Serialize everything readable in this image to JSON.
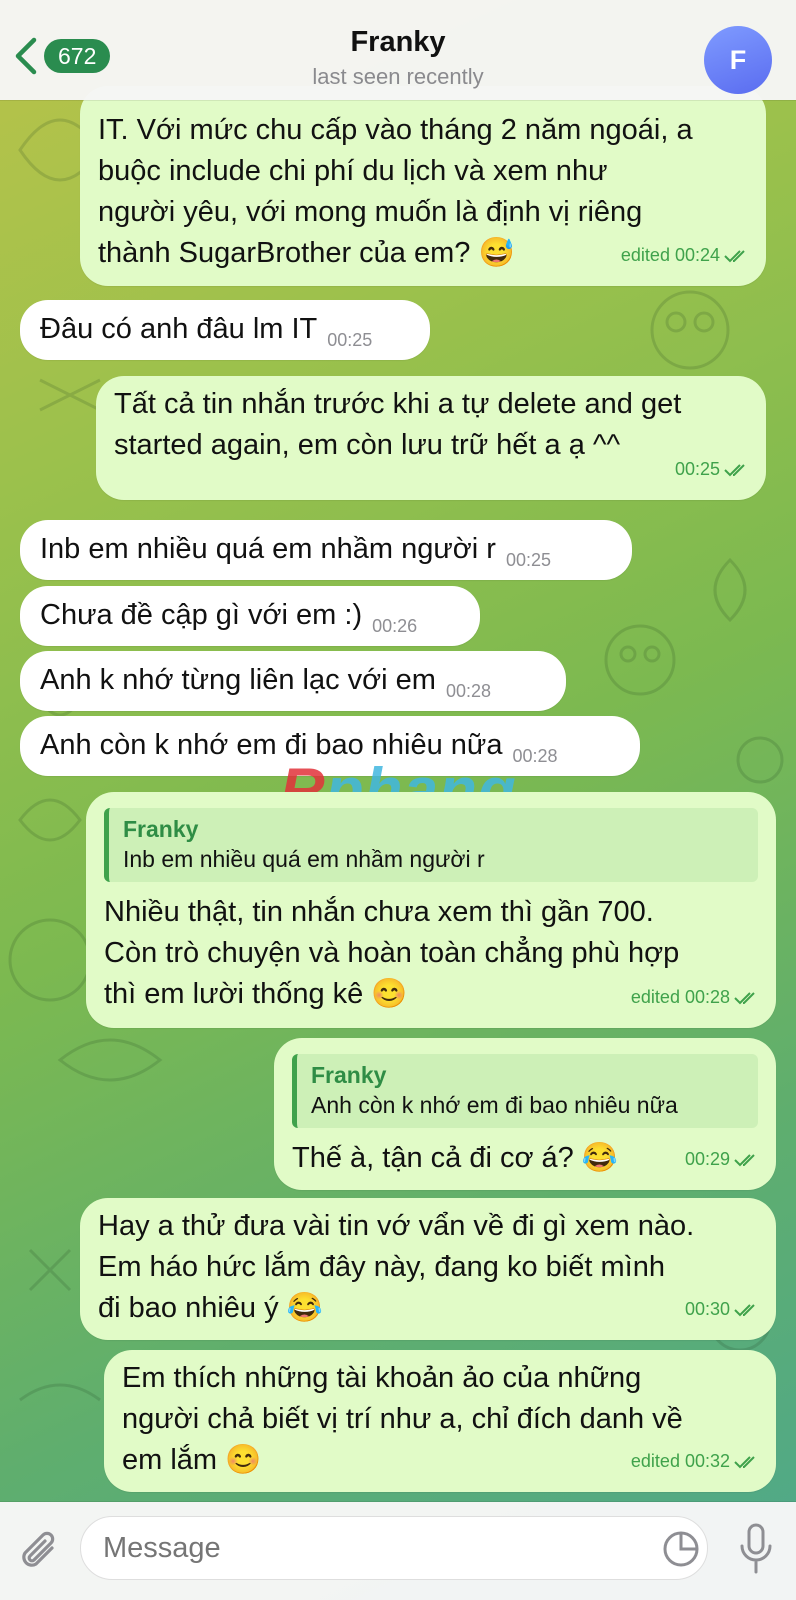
{
  "header": {
    "back_count": "672",
    "title": "Franky",
    "status": "last seen recently",
    "avatar_letter": "F"
  },
  "messages": [
    {
      "dir": "out",
      "text": "IT. Với mức chu cấp vào tháng 2 năm ngoái, a\nbuộc include chi phí du lịch và xem như\nngười yêu, với mong muốn là định vị riêng\nthành SugarBrother của em? 😅",
      "time": "edited 00:24"
    },
    {
      "dir": "in",
      "text": "Đâu có anh đâu lm IT",
      "time": "00:25"
    },
    {
      "dir": "out",
      "text": "Tất cả tin nhắn trước khi a tự delete and get\nstarted again, em còn lưu trữ hết a ạ ^^",
      "time": "00:25"
    },
    {
      "dir": "in",
      "text": "Inb em nhiều quá em nhầm người r",
      "time": "00:25"
    },
    {
      "dir": "in",
      "text": "Chưa đề cập gì với em :)",
      "time": "00:26"
    },
    {
      "dir": "in",
      "text": "Anh k nhớ từng liên lạc với em",
      "time": "00:28"
    },
    {
      "dir": "in",
      "text": "Anh còn k nhớ em đi bao nhiêu nữa",
      "time": "00:28"
    },
    {
      "dir": "out",
      "reply_name": "Franky",
      "reply_text": "Inb em nhiều quá em nhầm người r",
      "text": "Nhiều thật, tin nhắn chưa xem thì gần 700.\nCòn trò chuyện và hoàn toàn chẳng phù hợp\nthì em lười thống kê 😊",
      "time": "edited 00:28"
    },
    {
      "dir": "out",
      "reply_name": "Franky",
      "reply_text": "Anh còn k nhớ em đi bao nhiêu nữa",
      "text": "Thế à, tận cả đi cơ á? 😂",
      "time": "00:29"
    },
    {
      "dir": "out",
      "text": "Hay a thử đưa vài tin vớ vẩn về đi gì xem nào.\nEm háo hức lắm đây này, đang ko biết mình\nđi bao nhiêu ý 😂",
      "time": "00:30"
    },
    {
      "dir": "out",
      "text": "Em thích những tài khoản ảo của những\nngười chả biết vị trí như a, chỉ đích danh về\nem lắm 😊",
      "time": "edited 00:32"
    }
  ],
  "watermark": {
    "lead": "R",
    "rest": "phang"
  },
  "input": {
    "placeholder": "Message"
  },
  "colors": {
    "accent": "#3fa24b",
    "out_bubble": "#e1fbc7",
    "in_bubble": "#ffffff",
    "badge": "#2a8c4f"
  }
}
